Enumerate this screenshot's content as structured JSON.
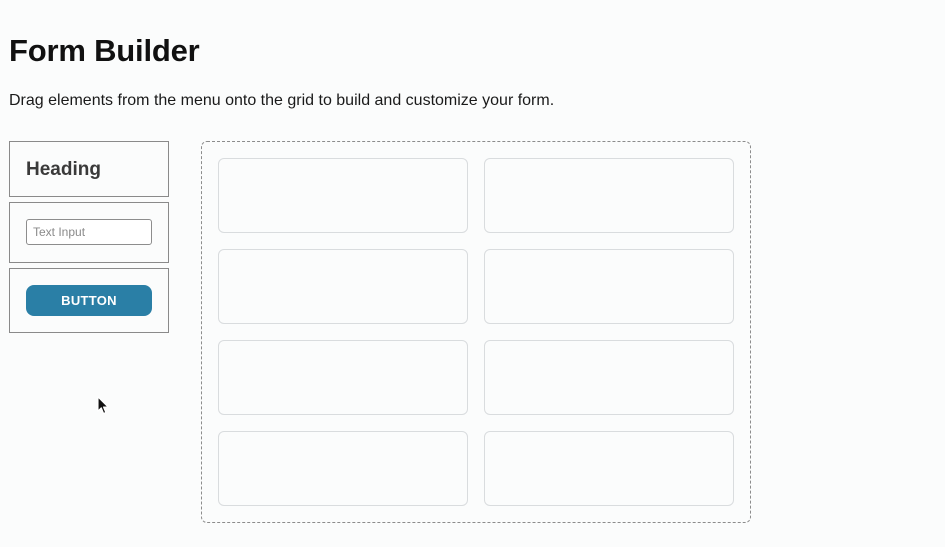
{
  "header": {
    "title": "Form Builder",
    "description": "Drag elements from the menu onto the grid to build and customize your form."
  },
  "palette": {
    "items": [
      {
        "type": "heading",
        "label": "Heading"
      },
      {
        "type": "text-input",
        "placeholder": "Text Input"
      },
      {
        "type": "button",
        "label": "BUTTON"
      }
    ]
  },
  "grid": {
    "columns": 2,
    "rows": 4,
    "cells": [
      "",
      "",
      "",
      "",
      "",
      "",
      "",
      ""
    ]
  },
  "colors": {
    "background": "#fbfcfc",
    "button_accent": "#2a7fa6",
    "palette_border": "#8a8a8a",
    "cell_border": "#d9dcde"
  },
  "icons": {
    "cursor": "mouse-pointer-icon"
  }
}
